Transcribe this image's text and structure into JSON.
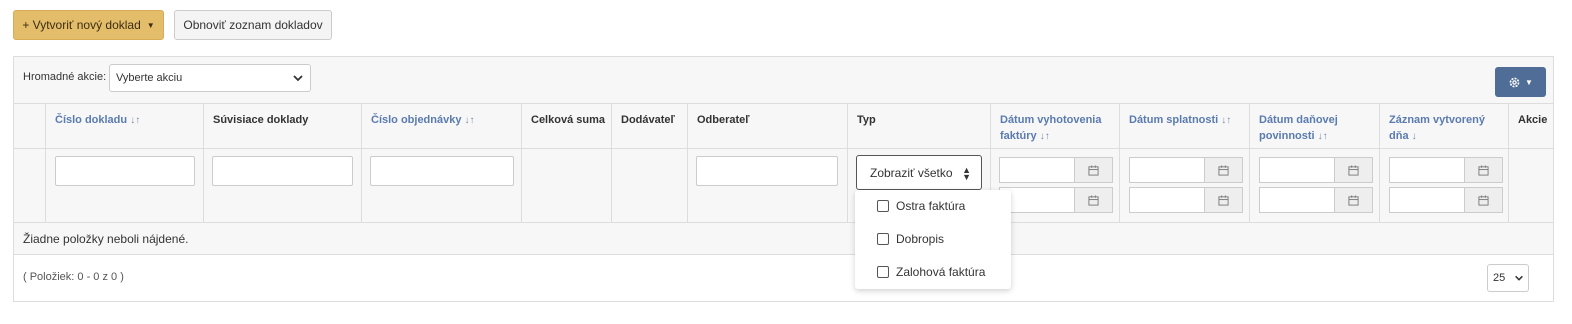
{
  "toolbar": {
    "create_label": "+ Vytvoriť nový doklad",
    "refresh_label": "Obnoviť zoznam dokladov"
  },
  "bulk": {
    "label": "Hromadné akcie:",
    "selected": "Vyberte akciu"
  },
  "table": {
    "columns": [
      {
        "label": "Číslo dokladu",
        "sortable": true
      },
      {
        "label": "Súvisiace doklady",
        "sortable": false
      },
      {
        "label": "Číslo objednávky",
        "sortable": true
      },
      {
        "label": "Celková suma",
        "sortable": false
      },
      {
        "label": "Dodávateľ",
        "sortable": false
      },
      {
        "label": "Odberateľ",
        "sortable": false
      },
      {
        "label": "Typ",
        "sortable": false
      },
      {
        "label": "Dátum vyhotovenia faktúry",
        "sortable": true
      },
      {
        "label": "Dátum splatnosti",
        "sortable": true
      },
      {
        "label": "Dátum daňovej povinnosti",
        "sortable": true
      },
      {
        "label": "Záznam vytvorený dňa",
        "sortable": true
      },
      {
        "label": "Akcie",
        "sortable": false
      }
    ],
    "sort_icon": "↓↑",
    "sort_desc_icon": "↓",
    "type_filter": {
      "selected": "Zobraziť všetko",
      "options": [
        "Ostra faktúra",
        "Dobropis",
        "Zalohová faktúra"
      ]
    },
    "empty_message": "Žiadne položky neboli nájdené.",
    "count_text": "( Položiek: 0 - 0 z 0 )",
    "page_size": "25"
  },
  "colors": {
    "create_button": "#e4bd6a",
    "settings_button": "#4f6d96",
    "link": "#5a7bb0"
  },
  "icons": [
    "chevron-down-icon",
    "gear-icon",
    "calendar-icon",
    "sort-icon",
    "checkbox-icon"
  ]
}
